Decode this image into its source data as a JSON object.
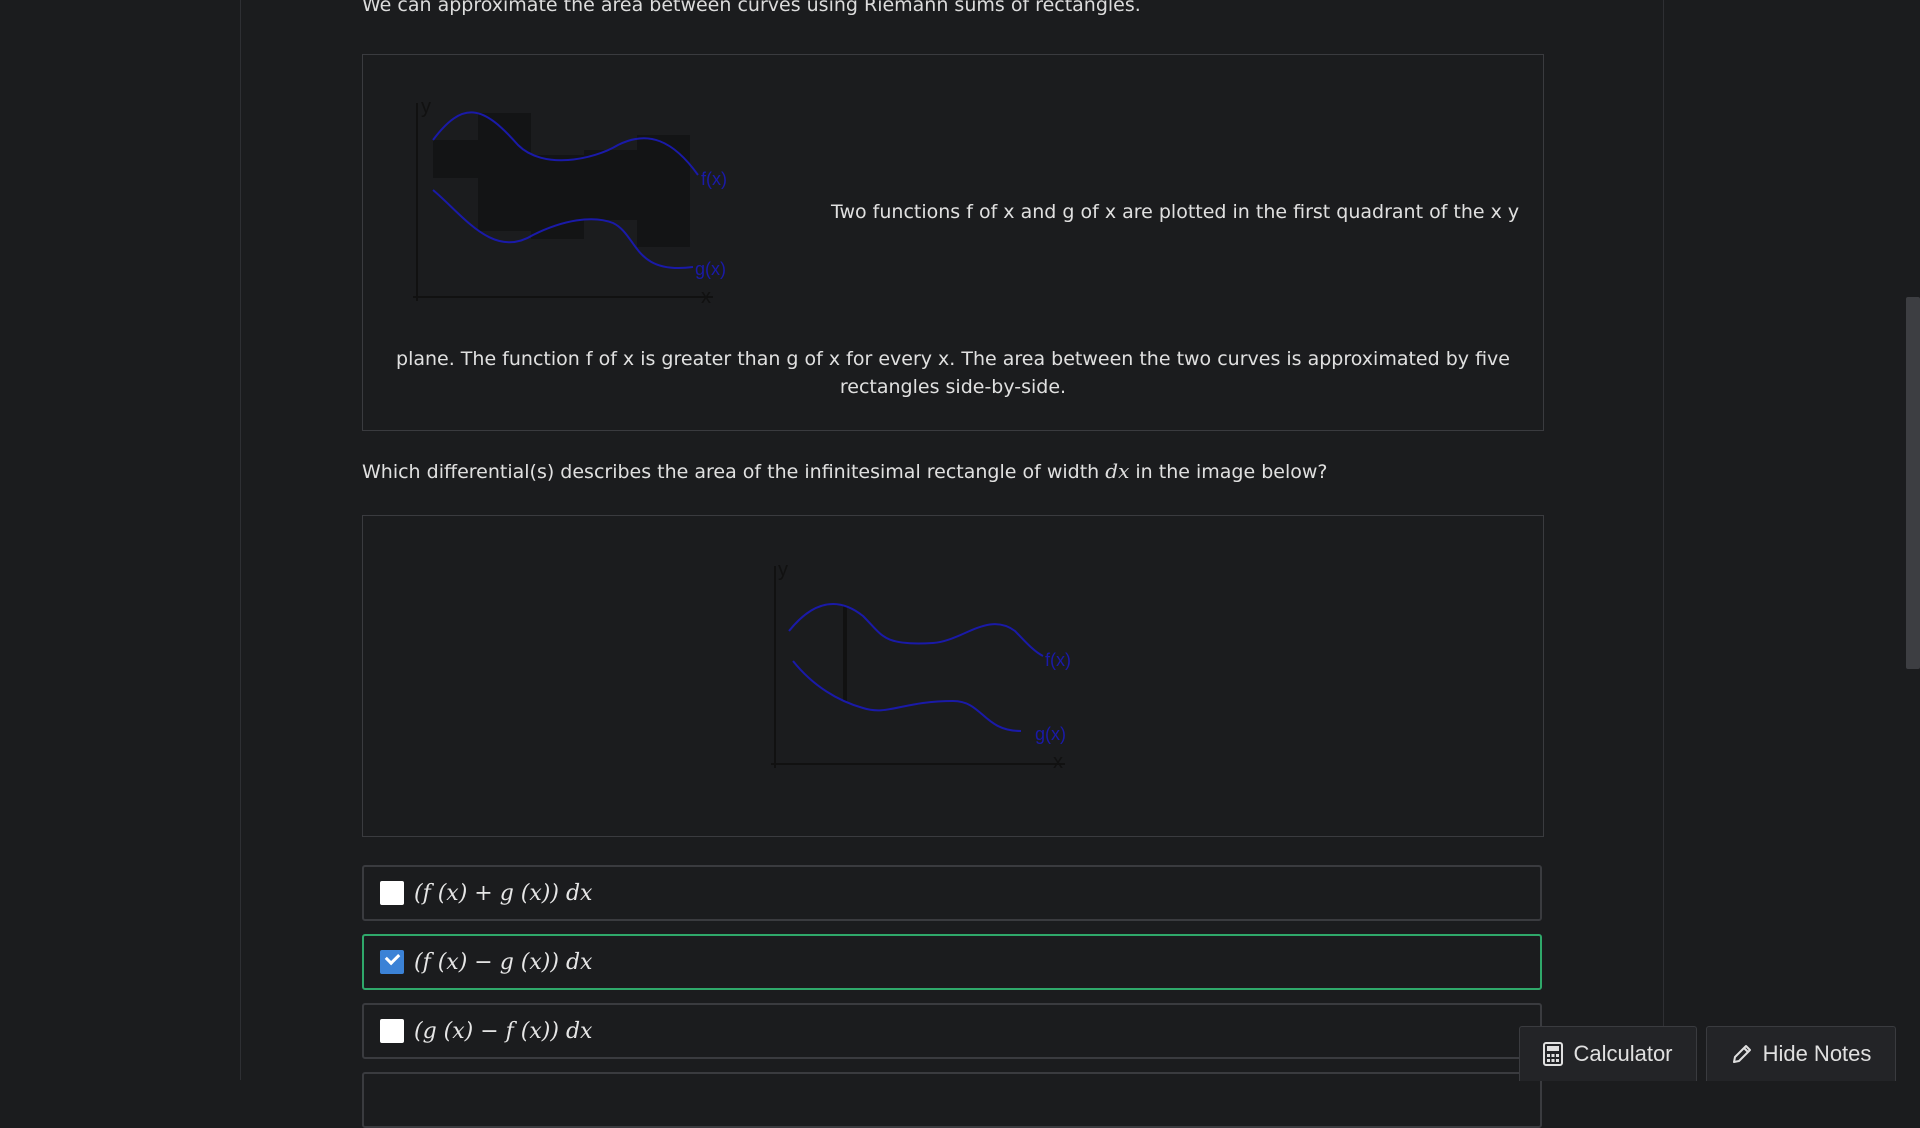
{
  "intro_text": "We can approximate the area between curves using Riemann sums of rectangles.",
  "figure1": {
    "label_y": "y",
    "label_x": "x",
    "label_f": "f(x)",
    "label_g": "g(x)",
    "description_right": "Two functions f of x and g of x are plotted in the first quadrant of the x y",
    "description_bottom": "plane. The function f of x is greater than g of x for every x. The area between the two curves is approximated by five rectangles side-by-side."
  },
  "question": {
    "prefix": "Which differential(s) describes the area of the infinitesimal rectangle of width ",
    "math": "dx",
    "suffix": " in the image below?"
  },
  "figure2": {
    "label_y": "y",
    "label_x": "x",
    "label_f": "f(x)",
    "label_g": "g(x)"
  },
  "options": [
    {
      "label": "(f (x) + g (x)) dx",
      "checked": false
    },
    {
      "label": "(f (x) − g (x)) dx",
      "checked": true
    },
    {
      "label": "(g (x) − f (x)) dx",
      "checked": false
    }
  ],
  "buttons": {
    "calculator": "Calculator",
    "hide_notes": "Hide Notes"
  },
  "colors": {
    "curve": "#1a1aa8",
    "selected_border": "#2fa86a",
    "checkbox_checked": "#3b82d6"
  }
}
